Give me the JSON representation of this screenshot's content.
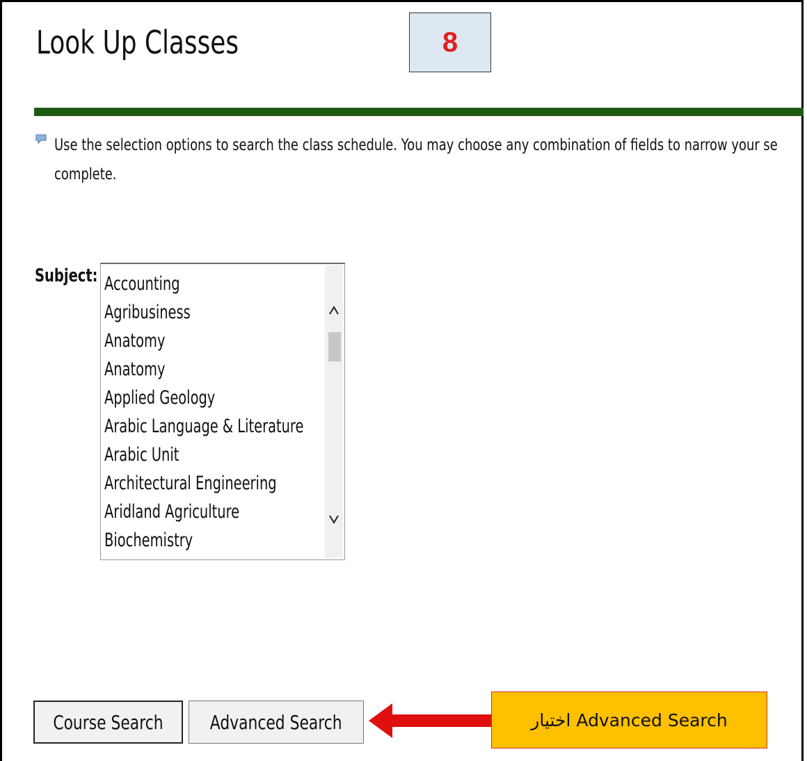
{
  "page": {
    "title": "Look Up Classes",
    "instructions_line1": "Use the selection options to search the class schedule. You may choose any combination of fields to narrow your se",
    "instructions_line2": "complete."
  },
  "step_badge": {
    "number": "8"
  },
  "subject": {
    "label": "Subject:",
    "options": [
      "Accounting",
      "Agribusiness",
      "Anatomy",
      "Anatomy",
      "Applied Geology",
      "Arabic Language & Literature",
      "Arabic Unit",
      "Architectural Engineering",
      "Aridland Agriculture",
      "Biochemistry"
    ]
  },
  "buttons": {
    "course_search": "Course Search",
    "advanced_search": "Advanced Search"
  },
  "callout": {
    "text": "اختيار Advanced Search"
  },
  "icons": {
    "info": "info-balloon-icon",
    "scroll_up": "chevron-up-icon",
    "scroll_down": "chevron-down-icon",
    "arrow": "left-arrow-icon"
  },
  "colors": {
    "rule": "#1e5a12",
    "badge_bg": "#dce8f2",
    "badge_text": "#e02020",
    "callout_bg": "#ffc000",
    "arrow": "#e01010"
  }
}
